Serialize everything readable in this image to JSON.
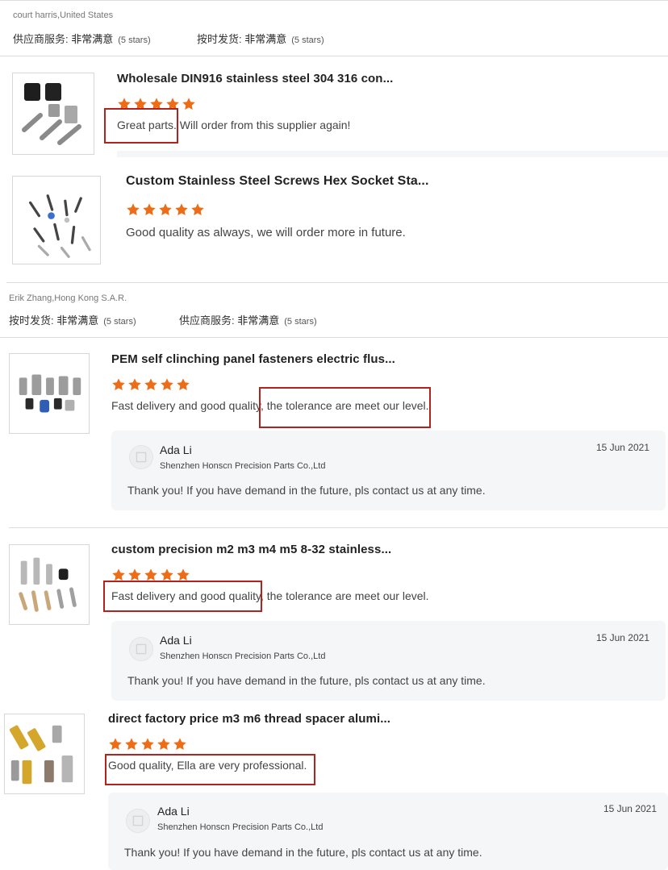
{
  "colors": {
    "star": "#ef6c17",
    "highlight_box": "#b3231e",
    "reply_bg": "#f5f6f7"
  },
  "reviews": [
    {
      "reviewer": "court harris,United States",
      "ratings": [
        {
          "label": "供应商服务:",
          "value": "非常满意",
          "stars_text": "(5 stars)"
        },
        {
          "label": "按时发货:",
          "value": "非常满意",
          "stars_text": "(5 stars)"
        }
      ],
      "products": [
        {
          "title": "Wholesale DIN916 stainless steel 304 316 con...",
          "stars": 5,
          "text": "Great parts. Will order from this supplier again!",
          "image_icon": "product-set-screws-icon"
        },
        {
          "title": "Custom Stainless Steel Screws Hex Socket Sta...",
          "stars": 5,
          "text": "Good quality as always, we will order more in future.",
          "image_icon": "product-hex-screws-icon"
        }
      ]
    },
    {
      "reviewer": "Erik Zhang,Hong Kong S.A.R.",
      "ratings": [
        {
          "label": "按时发货:",
          "value": "非常满意",
          "stars_text": "(5 stars)"
        },
        {
          "label": "供应商服务:",
          "value": "非常满意",
          "stars_text": "(5 stars)"
        }
      ],
      "products": [
        {
          "title": "PEM self clinching panel fasteners electric flus...",
          "stars": 5,
          "text": "Fast delivery and good quality, the tolerance are meet our level.",
          "image_icon": "product-pem-fasteners-icon",
          "reply": {
            "name": "Ada Li",
            "company": "Shenzhen Honscn Precision Parts Co.,Ltd",
            "date": "15 Jun 2021",
            "text": "Thank you! If you have demand in the future, pls contact us at any time."
          }
        },
        {
          "title": "custom precision m2 m3 m4 m5 8-32 stainless...",
          "stars": 5,
          "text": "Fast delivery and good quality, the tolerance are meet our level.",
          "image_icon": "product-precision-screws-icon",
          "reply": {
            "name": "Ada Li",
            "company": "Shenzhen Honscn Precision Parts Co.,Ltd",
            "date": "15 Jun 2021",
            "text": "Thank you! If you have demand in the future, pls contact us at any time."
          }
        },
        {
          "title": "direct factory price m3 m6 thread spacer alumi...",
          "stars": 5,
          "text": "Good quality, Ella are very professional.",
          "image_icon": "product-thread-spacer-icon",
          "reply": {
            "name": "Ada Li",
            "company": "Shenzhen Honscn Precision Parts Co.,Ltd",
            "date": "15 Jun 2021",
            "text": "Thank you! If you have demand in the future, pls contact us at any time."
          }
        }
      ]
    }
  ]
}
